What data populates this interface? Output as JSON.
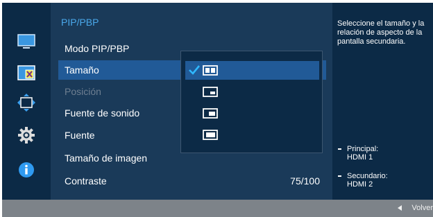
{
  "menu": {
    "title": "PIP/PBP",
    "items": [
      {
        "label": "Modo PIP/PBP",
        "state": "normal",
        "value": ""
      },
      {
        "label": "Tamaño",
        "state": "selected",
        "value": ""
      },
      {
        "label": "Posición",
        "state": "disabled",
        "value": ""
      },
      {
        "label": "Fuente de sonido",
        "state": "normal",
        "value": ""
      },
      {
        "label": "Fuente",
        "state": "normal",
        "value": ""
      },
      {
        "label": "Tamaño de imagen",
        "state": "normal",
        "value": ""
      },
      {
        "label": "Contraste",
        "state": "normal",
        "value": "75/100"
      }
    ]
  },
  "dropdown": {
    "options": [
      {
        "icon": "pbp-split-icon",
        "selected": true
      },
      {
        "icon": "pip-small-icon",
        "selected": false
      },
      {
        "icon": "pip-medium-icon",
        "selected": false
      },
      {
        "icon": "pip-large-icon",
        "selected": false
      }
    ],
    "check_icon": "checkmark-icon"
  },
  "categories": [
    {
      "icon": "picture-monitor-icon"
    },
    {
      "icon": "pip-pbp-icon",
      "active": true
    },
    {
      "icon": "onscreen-display-icon"
    },
    {
      "icon": "system-gear-icon"
    },
    {
      "icon": "information-icon"
    }
  ],
  "help": {
    "description": "Seleccione el tamaño y la relación de aspecto de la pantalla secundaria.",
    "principal_label": "Principal:",
    "principal_value": "HDMI 1",
    "secundario_label": "Secundario:",
    "secundario_value": "HDMI 2"
  },
  "footer": {
    "back_label": "Volver",
    "back_icon": "left-arrow-icon"
  },
  "colors": {
    "accent": "#4aa8ea",
    "selected_row": "#215a97",
    "panel": "#1a3a59",
    "dark_panel": "#0c2a46",
    "check": "#2fb8ff"
  }
}
